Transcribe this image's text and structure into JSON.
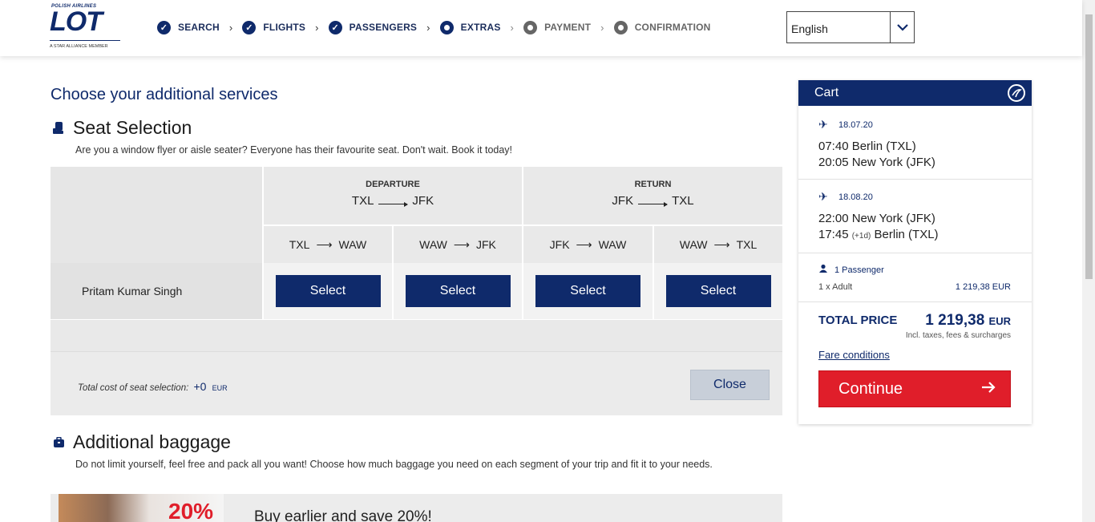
{
  "header": {
    "logo_small": "POLISH AIRLINES",
    "logo_main": "LOT",
    "logo_alliance": "A STAR ALLIANCE MEMBER",
    "steps": [
      {
        "label": "SEARCH",
        "state": "done"
      },
      {
        "label": "FLIGHTS",
        "state": "done"
      },
      {
        "label": "PASSENGERS",
        "state": "done"
      },
      {
        "label": "EXTRAS",
        "state": "current"
      },
      {
        "label": "PAYMENT",
        "state": "pending"
      },
      {
        "label": "CONFIRMATION",
        "state": "pending"
      }
    ],
    "language": "English"
  },
  "main": {
    "page_title": "Choose your additional services",
    "seat": {
      "title": "Seat Selection",
      "description": "Are you a window flyer or aisle seater? Everyone has their favourite seat. Don't wait. Book it today!",
      "departure": {
        "label": "DEPARTURE",
        "from": "TXL",
        "to": "JFK"
      },
      "return": {
        "label": "RETURN",
        "from": "JFK",
        "to": "TXL"
      },
      "segments": [
        {
          "from": "TXL",
          "to": "WAW"
        },
        {
          "from": "WAW",
          "to": "JFK"
        },
        {
          "from": "JFK",
          "to": "WAW"
        },
        {
          "from": "WAW",
          "to": "TXL"
        }
      ],
      "passenger": "Pritam Kumar Singh",
      "select_label": "Select",
      "total_cost_label": "Total cost of seat selection:",
      "total_cost_value": "+0",
      "total_cost_currency": "EUR",
      "close_label": "Close"
    },
    "baggage": {
      "title": "Additional baggage",
      "description": "Do not limit yourself, feel free and pack all you want! Choose how much baggage you need on each segment of your trip and fit it to your needs.",
      "promo_percent": "20%",
      "promo_text": "Buy earlier and save 20%!"
    }
  },
  "cart": {
    "title": "Cart",
    "flights": [
      {
        "date": "18.07.20",
        "dep": "07:40 Berlin (TXL)",
        "arr_time": "20:05",
        "arr_plus": "",
        "arr_place": "New York (JFK)"
      },
      {
        "date": "18.08.20",
        "dep": "22:00 New York (JFK)",
        "arr_time": "17:45",
        "arr_plus": "(+1d)",
        "arr_place": "Berlin (TXL)"
      }
    ],
    "passengers_label": "1 Passenger",
    "pax_type": "1 x Adult",
    "pax_amount": "1 219,38 EUR",
    "total_label": "TOTAL PRICE",
    "total_amount": "1 219,38",
    "total_currency": "EUR",
    "total_note": "Incl. taxes, fees & surcharges",
    "fare_conditions": "Fare conditions",
    "continue_label": "Continue"
  },
  "colors": {
    "brand_navy": "#0f2a6b",
    "continue_red": "#e01e2a"
  }
}
